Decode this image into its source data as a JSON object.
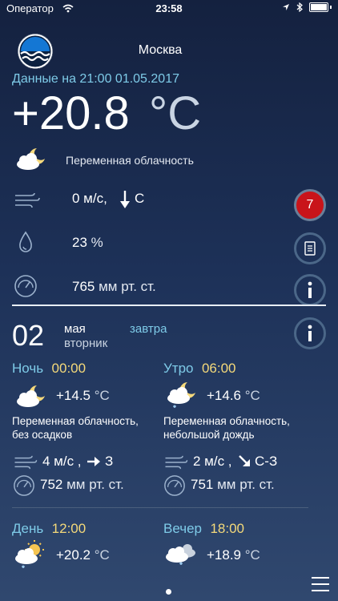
{
  "status_bar": {
    "carrier": "Оператор",
    "time": "23:58"
  },
  "header": {
    "city": "Москва",
    "updated": "Данные на 21:00 01.05.2017"
  },
  "current": {
    "temp": "+20.8",
    "temp_unit": "°C",
    "condition": "Переменная облачность",
    "wind_value": "0 м/с,",
    "wind_dir": "С",
    "humidity_value": "23",
    "humidity_unit": "%",
    "pressure_value": "765",
    "pressure_unit": "мм рт. ст.",
    "alerts_count": "7"
  },
  "forecast_day": {
    "day": "02",
    "month": "мая",
    "weekday": "вторник",
    "tag": "завтра"
  },
  "periods": [
    {
      "label": "Ночь",
      "time": "00:00",
      "temp": "+14.5",
      "unit": "°C",
      "desc": "Переменная облачность, без осадков",
      "wind": "4 м/с ,",
      "wind_dir": "З",
      "pressure": "752",
      "pressure_unit": "мм рт. ст."
    },
    {
      "label": "Утро",
      "time": "06:00",
      "temp": "+14.6",
      "unit": "°C",
      "desc": "Переменная облачность, небольшой дождь",
      "wind": "2 м/с ,",
      "wind_dir": "С-З",
      "pressure": "751",
      "pressure_unit": "мм рт. ст."
    },
    {
      "label": "День",
      "time": "12:00",
      "temp": "+20.2",
      "unit": "°C"
    },
    {
      "label": "Вечер",
      "time": "18:00",
      "temp": "+18.9",
      "unit": "°C"
    }
  ],
  "colors": {
    "accent": "#7ecbe8",
    "time": "#f4d97a",
    "alert": "#c9141a",
    "background": "#1d3158"
  }
}
